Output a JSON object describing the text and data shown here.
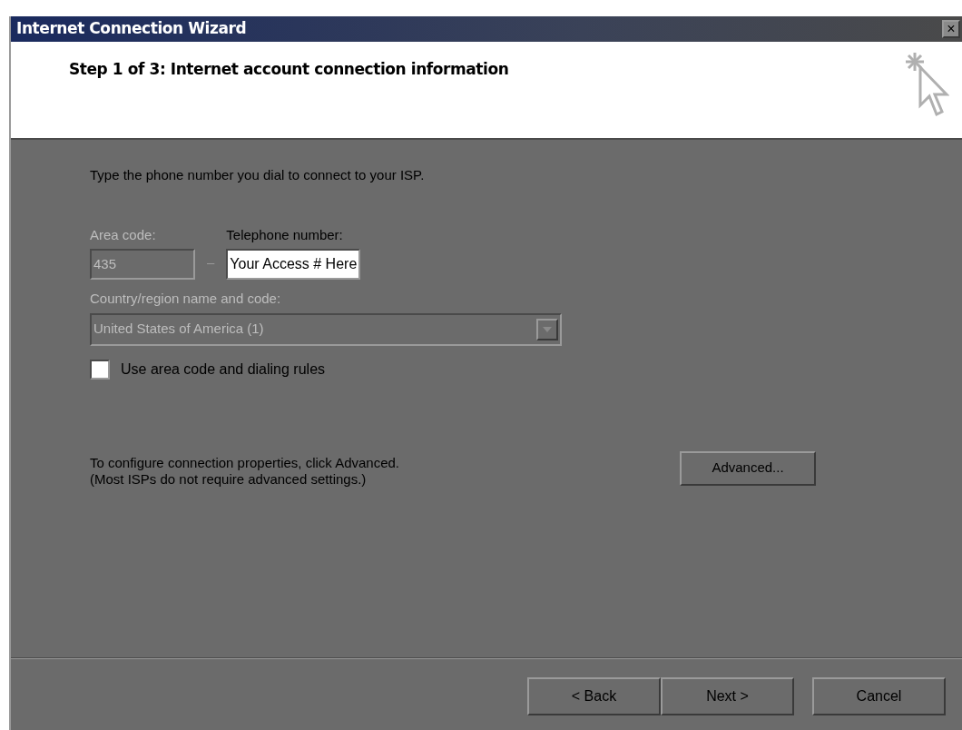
{
  "window": {
    "title": "Internet Connection Wizard",
    "close": "×"
  },
  "header": {
    "title": "Step 1 of 3: Internet account connection information"
  },
  "instruction": "Type the phone number you dial to connect to your ISP.",
  "area_code": {
    "label": "Area code:",
    "value": "435",
    "disabled": true
  },
  "separator": "–",
  "telephone": {
    "label": "Telephone number:",
    "value": "Your Access # Here",
    "disabled": false
  },
  "country": {
    "label": "Country/region name and code:",
    "value": "United States of America (1)",
    "disabled": true
  },
  "dialing_rules": {
    "label": "Use area code and dialing rules",
    "checked": false
  },
  "advanced_note": [
    "To configure connection properties, click Advanced.",
    "(Most ISPs do not require advanced settings.)"
  ],
  "advanced_button": "Advanced...",
  "nav_buttons": [
    "< Back",
    "Next >"
  ],
  "cancel_button": "Cancel"
}
